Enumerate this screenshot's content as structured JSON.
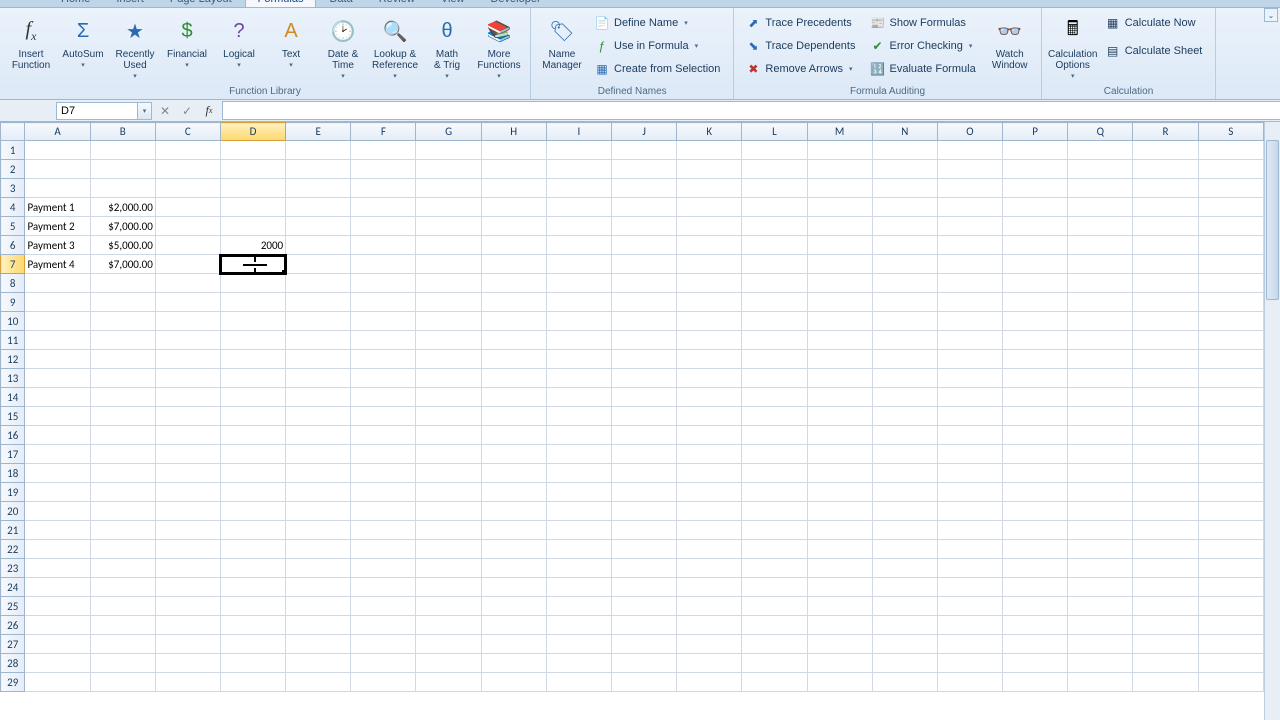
{
  "tabs": {
    "items": [
      "Home",
      "Insert",
      "Page Layout",
      "Formulas",
      "Data",
      "Review",
      "View",
      "Developer"
    ],
    "active_index": 3
  },
  "ribbon": {
    "groups": {
      "function_library": {
        "title": "Function Library",
        "insert_function": "Insert\nFunction",
        "autosum": "AutoSum",
        "recently_used": "Recently\nUsed",
        "financial": "Financial",
        "logical": "Logical",
        "text": "Text",
        "date_time": "Date &\nTime",
        "lookup_ref": "Lookup &\nReference",
        "math_trig": "Math\n& Trig",
        "more_functions": "More\nFunctions"
      },
      "defined_names": {
        "title": "Defined Names",
        "name_manager": "Name\nManager",
        "define_name": "Define Name",
        "use_in_formula": "Use in Formula",
        "create_from_selection": "Create from Selection"
      },
      "formula_auditing": {
        "title": "Formula Auditing",
        "trace_precedents": "Trace Precedents",
        "trace_dependents": "Trace Dependents",
        "remove_arrows": "Remove Arrows",
        "show_formulas": "Show Formulas",
        "error_checking": "Error Checking",
        "evaluate_formula": "Evaluate Formula",
        "watch_window": "Watch\nWindow"
      },
      "calculation": {
        "title": "Calculation",
        "calculation_options": "Calculation\nOptions",
        "calculate_now": "Calculate Now",
        "calculate_sheet": "Calculate Sheet"
      }
    }
  },
  "name_box": {
    "value": "D7"
  },
  "formula_bar": {
    "value": ""
  },
  "columns": [
    "A",
    "B",
    "C",
    "D",
    "E",
    "F",
    "G",
    "H",
    "I",
    "J",
    "K",
    "L",
    "M",
    "N",
    "O",
    "P",
    "Q",
    "R",
    "S"
  ],
  "active_col": "D",
  "active_row": 7,
  "row_count": 29,
  "cells": {
    "A4": "Payment 1",
    "B4": "$2,000.00",
    "A5": "Payment 2",
    "B5": "$7,000.00",
    "A6": "Payment 3",
    "B6": "$5,000.00",
    "D6": "2000",
    "A7": "Payment 4",
    "B7": "$7,000.00"
  },
  "selection": {
    "cell": "D7"
  }
}
